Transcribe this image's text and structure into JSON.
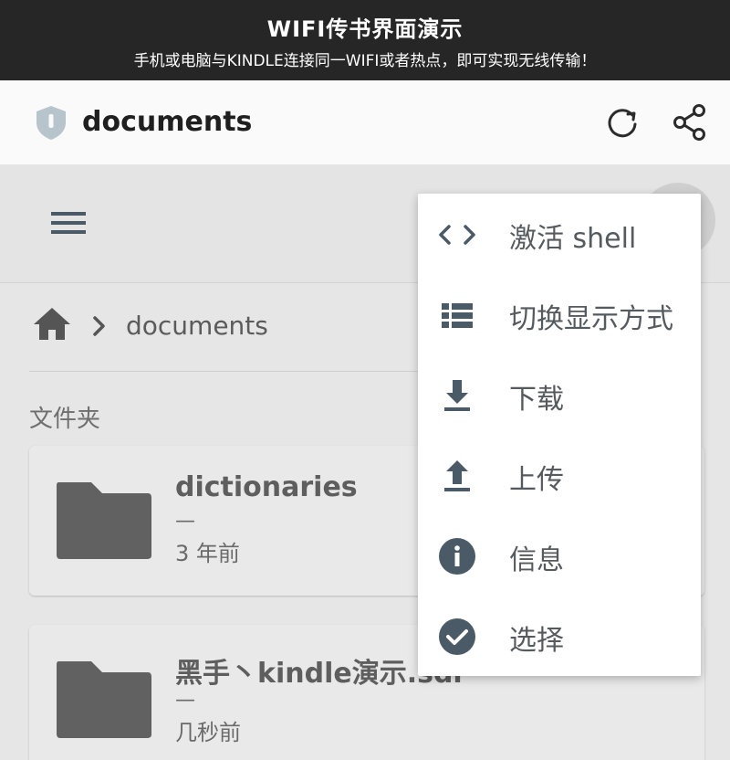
{
  "banner": {
    "title": "WIFI传书界面演示",
    "subtitle": "手机或电脑与KINDLE连接同一WIFI或者热点，即可实现无线传输！"
  },
  "appbar": {
    "title": "documents",
    "logo_icon": "shield-icon",
    "refresh_icon": "refresh-icon",
    "share_icon": "share-icon"
  },
  "toolbar": {
    "menu_icon": "hamburger-menu-icon"
  },
  "breadcrumb": {
    "home_icon": "home-icon",
    "separator_icon": "chevron-right-icon",
    "current": "documents"
  },
  "folders": {
    "section_label": "文件夹",
    "items": [
      {
        "name": "dictionaries",
        "size": "—",
        "time": "3 年前"
      },
      {
        "name": "黑手丶kindle演示.sdr",
        "size": "—",
        "time": "几秒前"
      }
    ]
  },
  "menu": {
    "items": [
      {
        "icon": "code-icon",
        "label": "激活 shell"
      },
      {
        "icon": "list-view-icon",
        "label": "切换显示方式"
      },
      {
        "icon": "download-icon",
        "label": "下载"
      },
      {
        "icon": "upload-icon",
        "label": "上传"
      },
      {
        "icon": "info-icon",
        "label": "信息"
      },
      {
        "icon": "check-circle-icon",
        "label": "选择"
      }
    ]
  },
  "colors": {
    "banner_bg": "#262626",
    "appbar_bg": "#fafafa",
    "page_bg": "#e6e6e6",
    "icon_slate": "#4a5a66",
    "folder_gray": "#616161"
  }
}
